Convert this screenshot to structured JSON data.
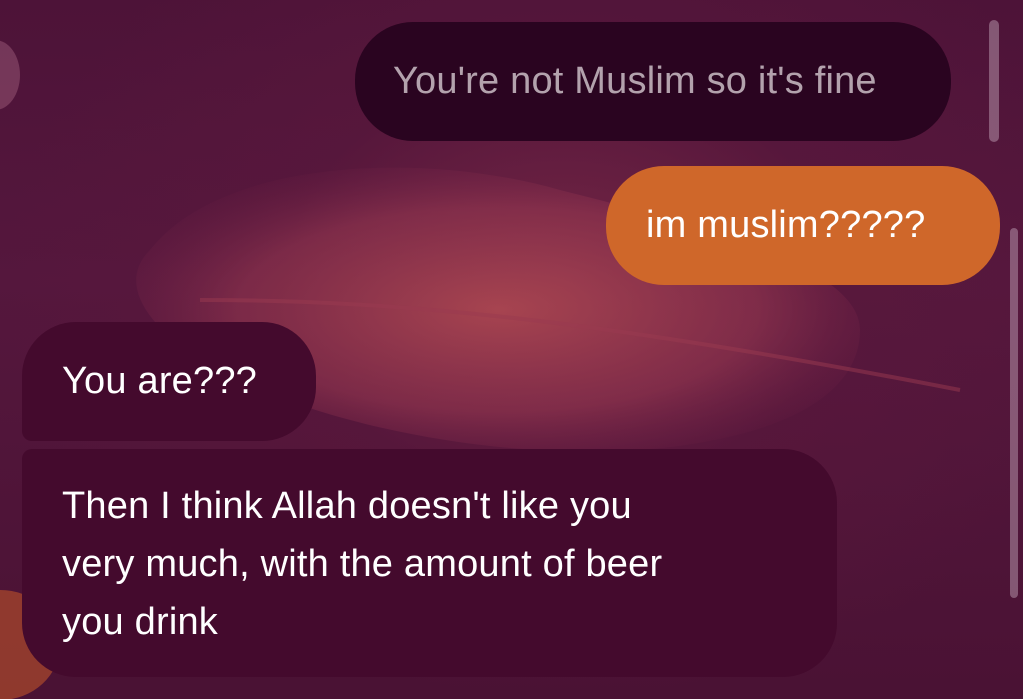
{
  "conversation": {
    "messages": [
      {
        "sender": "me",
        "style": "muted",
        "lines": [
          "You're not Muslim so it's fine"
        ]
      },
      {
        "sender": "me",
        "style": "accent",
        "lines": [
          "im muslim?????"
        ]
      },
      {
        "sender": "other",
        "lines": [
          "You are???"
        ]
      },
      {
        "sender": "other",
        "lines": [
          "Then I think Allah doesn't like you",
          "very much, with the amount of beer",
          "you drink"
        ]
      }
    ]
  },
  "colors": {
    "background": "#4a1235",
    "muted_bubble": "#2a0420",
    "muted_text": "#b3a2ad",
    "accent_bubble": "#cf672a",
    "received_bubble": "#440a2d",
    "received_text": "#ffffff"
  }
}
